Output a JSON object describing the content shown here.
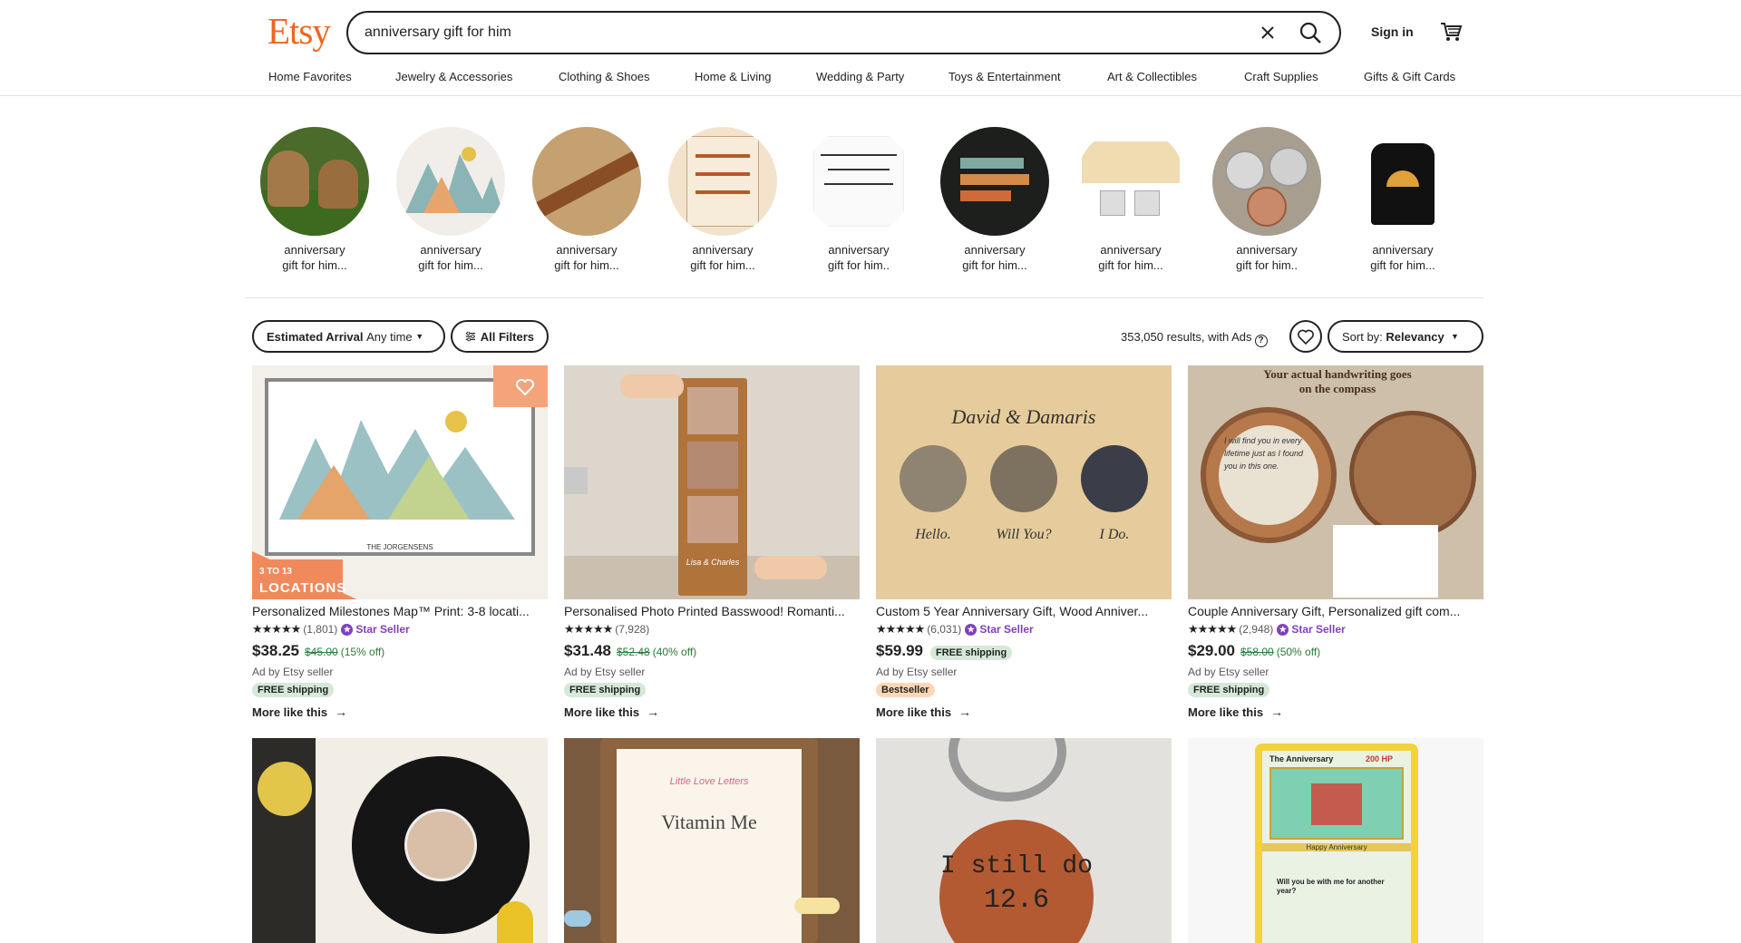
{
  "header": {
    "logo": "Etsy",
    "search_value": "anniversary gift for him",
    "signin": "Sign in"
  },
  "categories": [
    "Home Favorites",
    "Jewelry & Accessories",
    "Clothing & Shoes",
    "Home & Living",
    "Wedding & Party",
    "Toys & Entertainment",
    "Art & Collectibles",
    "Craft Supplies",
    "Gifts & Gift Cards"
  ],
  "circles": [
    {
      "l1": "anniversary",
      "l2": "gift for him..."
    },
    {
      "l1": "anniversary",
      "l2": "gift for him..."
    },
    {
      "l1": "anniversary",
      "l2": "gift for him..."
    },
    {
      "l1": "anniversary",
      "l2": "gift for him..."
    },
    {
      "l1": "anniversary",
      "l2": "gift for him.."
    },
    {
      "l1": "anniversary",
      "l2": "gift for him..."
    },
    {
      "l1": "anniversary",
      "l2": "gift for him..."
    },
    {
      "l1": "anniversary",
      "l2": "gift for him.."
    },
    {
      "l1": "anniversary",
      "l2": "gift for him..."
    }
  ],
  "filters": {
    "arrival_label": "Estimated Arrival",
    "arrival_value": "Any time",
    "all_filters": "All Filters",
    "results": "353,050 results, with Ads",
    "sort_label": "Sort by:",
    "sort_value": "Relevancy"
  },
  "listings": [
    {
      "title": "Personalized Milestones Map™ Print: 3-8 locati...",
      "stars": "★★★★★",
      "reviews": "(1,801)",
      "star_seller": "Star Seller",
      "price": "$38.25",
      "orig": "$45.00",
      "off": "(15% off)",
      "ad": "Ad by Etsy seller",
      "chip": "FREE shipping",
      "more": "More like this",
      "ribbon1": "3 TO 13",
      "ribbon2": "LOCATIONS",
      "caption": "THE JORGENSENS"
    },
    {
      "title": "Personalised Photo Printed Basswood! Romanti...",
      "stars": "★★★★★",
      "reviews": "(7,928)",
      "price": "$31.48",
      "orig": "$52.48",
      "off": "(40% off)",
      "ad": "Ad by Etsy seller",
      "chip": "FREE shipping",
      "more": "More like this",
      "caption": "Lisa & Charles"
    },
    {
      "title": "Custom 5 Year Anniversary Gift, Wood Anniver...",
      "stars": "★★★★★",
      "reviews": "(6,031)",
      "star_seller": "Star Seller",
      "price": "$59.99",
      "badge": "FREE shipping",
      "ad": "Ad by Etsy seller",
      "chip": "Bestseller",
      "more": "More like this",
      "caption": "David & Damaris",
      "w1": "Hello.",
      "w2": "Will You?",
      "w3": "I Do."
    },
    {
      "title": "Couple Anniversary Gift, Personalized gift com...",
      "stars": "★★★★★",
      "reviews": "(2,948)",
      "star_seller": "Star Seller",
      "price": "$29.00",
      "orig": "$58.00",
      "off": "(50% off)",
      "ad": "Ad by Etsy seller",
      "chip": "FREE shipping",
      "more": "More like this",
      "caption": "Your actual handwriting goes on the compass",
      "note": "I will find you in every lifetime just as I found you in this one."
    }
  ],
  "row2": {
    "vitamin": "Vitamin Me",
    "vitamin_top": "Little Love Letters",
    "keychain": "I still do",
    "keychain_num": "12.6",
    "card_title": "The Anniversary",
    "card_hp": "200 HP",
    "card_sub": "Happy Anniversary",
    "card_q": "Will you be with me for another year?"
  },
  "colors": {
    "brand": "#f1641e",
    "star_seller": "#7f3fbf",
    "sale": "#2a7a3b"
  }
}
